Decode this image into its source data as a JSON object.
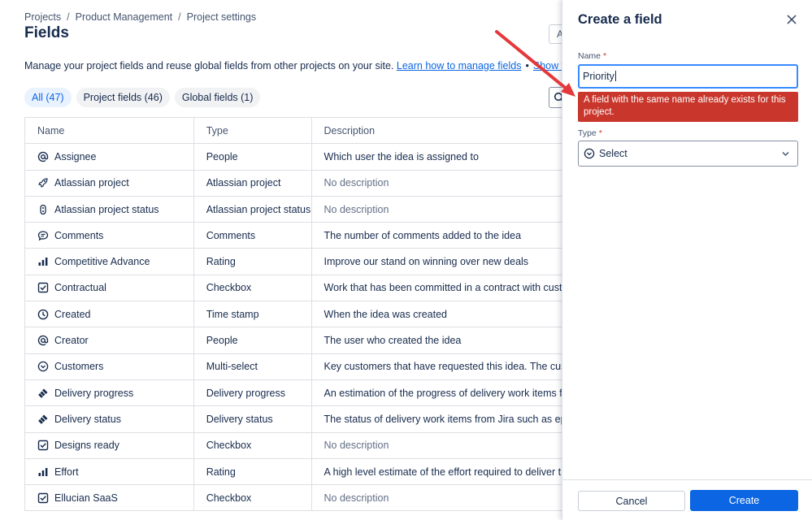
{
  "breadcrumb": [
    "Projects",
    "Product Management",
    "Project settings"
  ],
  "page_title": "Fields",
  "top_button_label": "A",
  "intro": {
    "text": "Manage your project fields and reuse global fields from other projects on your site.",
    "link1": "Learn how to manage fields",
    "separator": "•",
    "link2": "Show fields tou"
  },
  "chips": [
    {
      "label": "All (47)",
      "active": true
    },
    {
      "label": "Project fields (46)",
      "active": false
    },
    {
      "label": "Global fields (1)",
      "active": false
    }
  ],
  "table": {
    "headers": [
      "Name",
      "Type",
      "Description"
    ],
    "rows": [
      {
        "icon": "at-icon",
        "name": "Assignee",
        "type": "People",
        "description": "Which user the idea is assigned to",
        "muted": false
      },
      {
        "icon": "rocket-icon",
        "name": "Atlassian project",
        "type": "Atlassian project",
        "description": "No description",
        "muted": true
      },
      {
        "icon": "status-icon",
        "name": "Atlassian project status",
        "type": "Atlassian project status",
        "description": "No description",
        "muted": true
      },
      {
        "icon": "comment-icon",
        "name": "Comments",
        "type": "Comments",
        "description": "The number of comments added to the idea",
        "muted": false
      },
      {
        "icon": "rating-icon",
        "name": "Competitive Advance",
        "type": "Rating",
        "description": "Improve our stand on winning over new deals",
        "muted": false
      },
      {
        "icon": "checkbox-icon",
        "name": "Contractual",
        "type": "Checkbox",
        "description": "Work that has been committed in a contract with custome",
        "muted": false
      },
      {
        "icon": "clock-icon",
        "name": "Created",
        "type": "Time stamp",
        "description": "When the idea was created",
        "muted": false
      },
      {
        "icon": "at-icon",
        "name": "Creator",
        "type": "People",
        "description": "The user who created the idea",
        "muted": false
      },
      {
        "icon": "multiselect-icon",
        "name": "Customers",
        "type": "Multi-select",
        "description": "Key customers that have requested this idea. The custome",
        "muted": false
      },
      {
        "icon": "jira-icon",
        "name": "Delivery progress",
        "type": "Delivery progress",
        "description": "An estimation of the progress of delivery work items from",
        "muted": false
      },
      {
        "icon": "jira-icon",
        "name": "Delivery status",
        "type": "Delivery status",
        "description": "The status of delivery work items from Jira such as epics",
        "muted": false
      },
      {
        "icon": "checkbox-icon",
        "name": "Designs ready",
        "type": "Checkbox",
        "description": "No description",
        "muted": true
      },
      {
        "icon": "rating-icon",
        "name": "Effort",
        "type": "Rating",
        "description": "A high level estimate of the effort required to deliver this id",
        "muted": false
      },
      {
        "icon": "checkbox-icon",
        "name": "Ellucian SaaS",
        "type": "Checkbox",
        "description": "No description",
        "muted": true
      }
    ]
  },
  "panel": {
    "title": "Create a field",
    "name_label": "Name",
    "required_mark": "*",
    "name_value": "Priority",
    "error": "A field with the same name already exists for this project.",
    "type_label": "Type",
    "type_placeholder": "Select",
    "cancel_label": "Cancel",
    "create_label": "Create"
  },
  "colors": {
    "accent": "#0c66e4",
    "error": "#c9372c",
    "annotation_arrow": "#e5383b",
    "focus_border": "#388bff"
  }
}
